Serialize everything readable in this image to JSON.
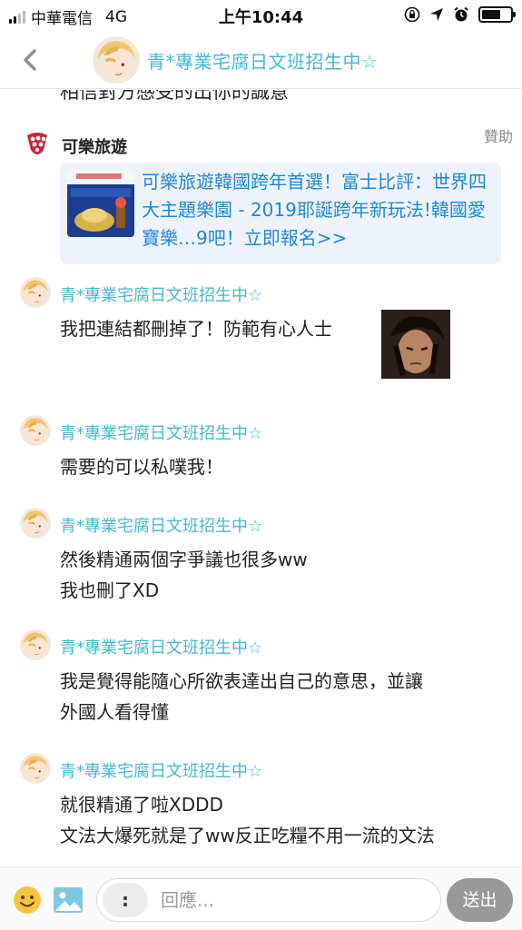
{
  "status_bar": {
    "carrier": "中華電信",
    "network": "4G",
    "time": "上午10:44",
    "battery_level": 0.65
  },
  "header": {
    "title": "青*專業宅腐日文班招生中☆"
  },
  "chat": {
    "previous_line": "相信對方感受的出你的誠意",
    "ad": {
      "sponsor_label": "贊助",
      "advertiser": "可樂旅遊",
      "text": "可樂旅遊韓國跨年首選！富士比評：世界四大主題樂園 - 2019耶誕跨年新玩法!韓國愛寶樂…9吧！立即報名>>"
    },
    "messages": [
      {
        "sender": "青*專業宅腐日文班招生中☆",
        "lines": [
          "我把連結都刪掉了！防範有心人士"
        ]
      },
      {
        "sender": "青*專業宅腐日文班招生中☆",
        "lines": [
          "需要的可以私噗我！"
        ]
      },
      {
        "sender": "青*專業宅腐日文班招生中☆",
        "lines": [
          "然後精通兩個字爭議也很多ww",
          "我也刪了XD"
        ]
      },
      {
        "sender": "青*專業宅腐日文班招生中☆",
        "lines": [
          "我是覺得能隨心所欲表達出自己的意思，並讓",
          "外國人看得懂"
        ]
      },
      {
        "sender": "青*專業宅腐日文班招生中☆",
        "lines": [
          "就很精通了啦XDDD",
          "文法大爆死就是了ww反正吃糧不用一流的文法"
        ]
      }
    ]
  },
  "input_bar": {
    "more_label": ":",
    "placeholder": "回應...",
    "send_label": "送出"
  },
  "colors": {
    "accent": "#46b9d3",
    "link": "#1e88d8",
    "send_button": "#999999"
  }
}
